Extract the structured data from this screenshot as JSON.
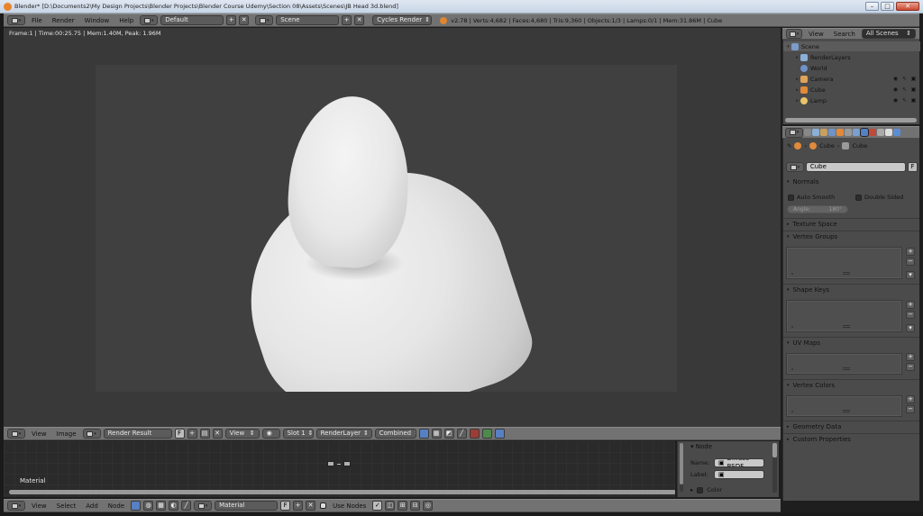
{
  "window": {
    "title": "Blender* [D:\\Documents2\\My Design Projects\\Blender Projects\\Blender Course Udemy\\Section 08\\Assets\\Scenes\\JB Head 3d.blend]",
    "controls": {
      "minimize": "–",
      "maximize": "□",
      "close": "✕"
    }
  },
  "info_header": {
    "menus": [
      "File",
      "Render",
      "Window",
      "Help"
    ],
    "layout": "Default",
    "scene": "Scene",
    "engine": "Cycles Render",
    "stats": "v2.78 | Verts:4,682 | Faces:4,680 | Tris:9,360 | Objects:1/3 | Lamps:0/1 | Mem:31.86M | Cube"
  },
  "viewport": {
    "info": "Frame:1 | Time:00:25.75 | Mem:1.40M, Peak: 1.96M"
  },
  "image_header": {
    "menus": [
      "View",
      "Image"
    ],
    "image": "Render Result",
    "fake_user": "F",
    "view": "View",
    "slot": "Slot 1",
    "layer": "RenderLayer",
    "pass": "Combined"
  },
  "node_editor": {
    "material_label": "Material"
  },
  "node_panel": {
    "header": "Node",
    "name_label": "Name:",
    "name_value": "Diffuse BSDF",
    "label_label": "Label:",
    "label_value": "",
    "color_header": "Color"
  },
  "node_header": {
    "menus": [
      "View",
      "Select",
      "Add",
      "Node"
    ],
    "material": "Material",
    "fake_user": "F",
    "use_nodes": "Use Nodes"
  },
  "outliner": {
    "menus": [
      "View",
      "Search"
    ],
    "display": "All Scenes",
    "items": [
      {
        "label": "Scene",
        "color": "#7c9bc9"
      },
      {
        "label": "RenderLayers",
        "color": "#8ab0d8"
      },
      {
        "label": "World",
        "color": "#6f93c8"
      },
      {
        "label": "Camera",
        "color": "#e0a35a"
      },
      {
        "label": "Cube",
        "color": "#e08a3a"
      },
      {
        "label": "Lamp",
        "color": "#e8c46a"
      }
    ]
  },
  "properties": {
    "breadcrumb": [
      "Cube",
      "Cube"
    ],
    "mesh_name": "Cube",
    "fake_user": "F",
    "panels": {
      "normals": "Normals",
      "auto_smooth": "Auto Smooth",
      "double_sided": "Double Sided",
      "angle_label": "Angle:",
      "angle_value": "180°",
      "texture_space": "Texture Space",
      "vertex_groups": "Vertex Groups",
      "shape_keys": "Shape Keys",
      "uv_maps": "UV Maps",
      "vertex_colors": "Vertex Colors",
      "geometry_data": "Geometry Data",
      "custom_properties": "Custom Properties"
    }
  },
  "colors": {
    "header": "#727272",
    "panel": "#4b4b4b",
    "viewport": "#393939",
    "accent_blue": "#5680c2",
    "blender_orange": "#e08530"
  }
}
